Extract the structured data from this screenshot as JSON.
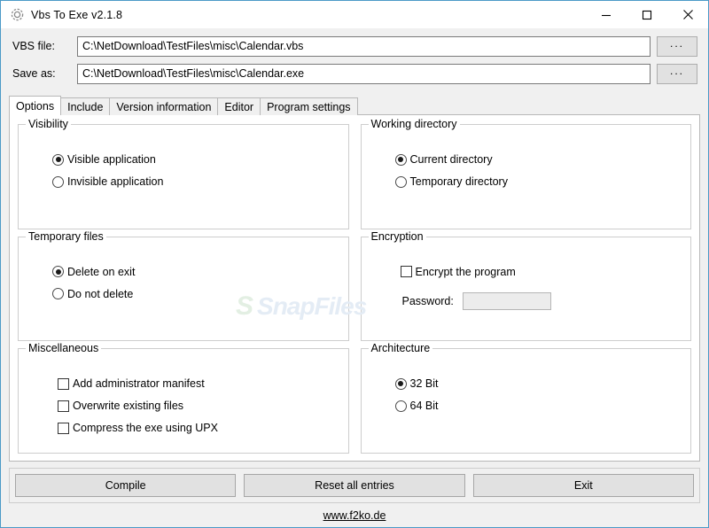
{
  "window": {
    "title": "Vbs To Exe v2.1.8",
    "icon": "gear-icon",
    "controls": [
      {
        "name": "minimize",
        "glyph": "minimize-icon"
      },
      {
        "name": "maximize",
        "glyph": "maximize-icon"
      },
      {
        "name": "close",
        "glyph": "close-icon"
      }
    ]
  },
  "file_fields": [
    {
      "label": "VBS file:",
      "value": "C:\\NetDownload\\TestFiles\\misc\\Calendar.vbs",
      "placeholder": "",
      "browse_label": "..."
    },
    {
      "label": "Save as:",
      "value": "C:\\NetDownload\\TestFiles\\misc\\Calendar.exe",
      "placeholder": "",
      "browse_label": "..."
    }
  ],
  "tabs": [
    {
      "label": "Options",
      "active": true
    },
    {
      "label": "Include",
      "active": false
    },
    {
      "label": "Version information",
      "active": false
    },
    {
      "label": "Editor",
      "active": false
    },
    {
      "label": "Program settings",
      "active": false
    }
  ],
  "groups": {
    "visibility": {
      "title": "Visibility",
      "options": [
        {
          "label": "Visible application",
          "checked": true
        },
        {
          "label": "Invisible application",
          "checked": false
        }
      ]
    },
    "working_directory": {
      "title": "Working directory",
      "options": [
        {
          "label": "Current directory",
          "checked": true
        },
        {
          "label": "Temporary directory",
          "checked": false
        }
      ]
    },
    "temporary_files": {
      "title": "Temporary files",
      "options": [
        {
          "label": "Delete on exit",
          "checked": true
        },
        {
          "label": "Do not delete",
          "checked": false
        }
      ]
    },
    "encryption": {
      "title": "Encryption",
      "checkbox": {
        "label": "Encrypt the program",
        "checked": false
      },
      "password_label": "Password:",
      "password_value": "",
      "password_placeholder": ""
    },
    "miscellaneous": {
      "title": "Miscellaneous",
      "options": [
        {
          "label": "Add administrator manifest",
          "checked": false
        },
        {
          "label": "Overwrite existing files",
          "checked": false
        },
        {
          "label": "Compress the exe using UPX",
          "checked": false
        }
      ]
    },
    "architecture": {
      "title": "Architecture",
      "options": [
        {
          "label": "32 Bit",
          "checked": true
        },
        {
          "label": "64 Bit",
          "checked": false
        }
      ]
    }
  },
  "actions": [
    {
      "label": "Compile"
    },
    {
      "label": "Reset all entries"
    },
    {
      "label": "Exit"
    }
  ],
  "footer": {
    "link": "www.f2ko.de"
  },
  "watermark": {
    "logo": "S",
    "text": "SnapFiles"
  },
  "colors": {
    "window_border": "#4b9ac7",
    "chrome": "#f0f0f0",
    "panel": "#ffffff",
    "group_border": "#cdcdcd",
    "button_face": "#e1e1e1",
    "input_border": "#7a7a7a"
  }
}
